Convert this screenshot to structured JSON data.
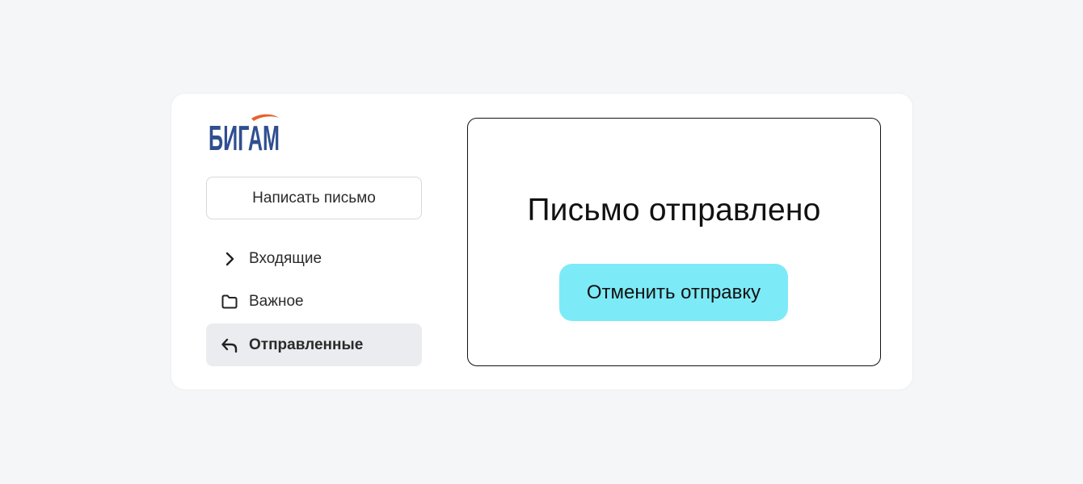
{
  "brand": {
    "logo_text": "БИГАМ",
    "logo_color": "#2f4f8f",
    "logo_accent": "#e8612c"
  },
  "sidebar": {
    "compose_label": "Написать письмо",
    "items": [
      {
        "label": "Входящие",
        "icon": "chevron-right-icon",
        "active": false
      },
      {
        "label": "Важное",
        "icon": "folder-icon",
        "active": false
      },
      {
        "label": "Отправленные",
        "icon": "reply-arrow-icon",
        "active": true
      }
    ]
  },
  "main": {
    "title": "Письмо отправлено",
    "undo_label": "Отменить отправку",
    "undo_color": "#7deaf7"
  }
}
